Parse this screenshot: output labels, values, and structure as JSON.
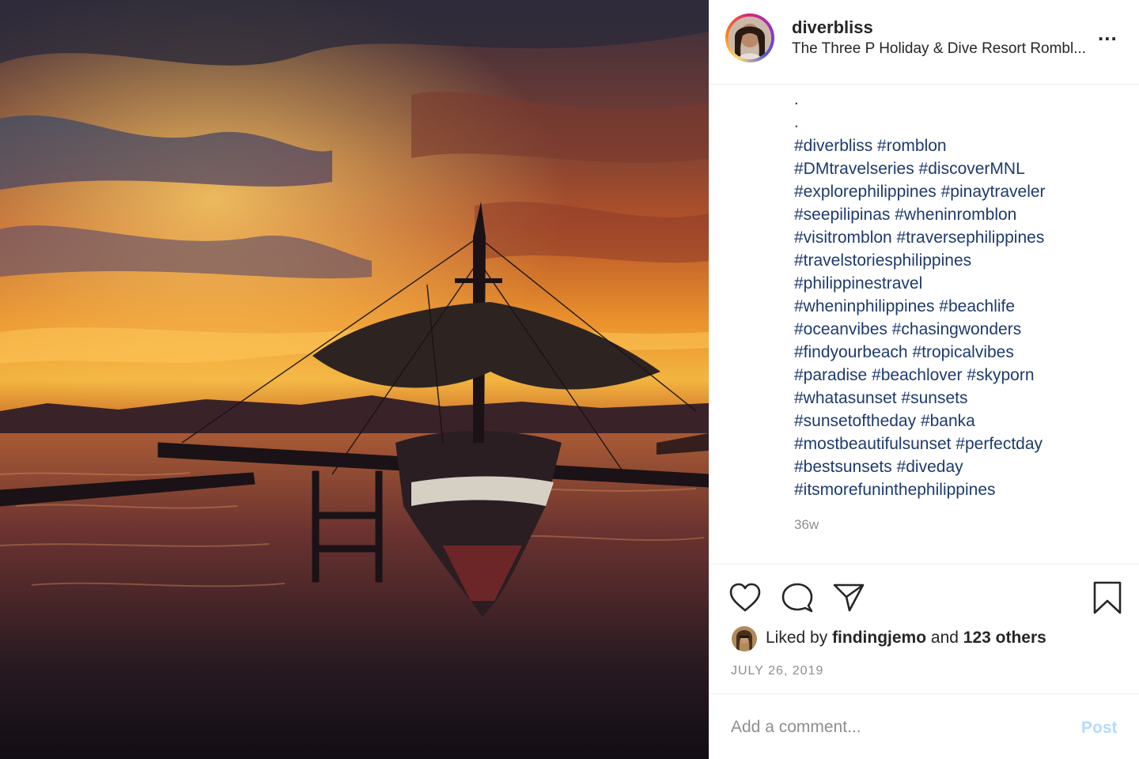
{
  "post": {
    "username": "diverbliss",
    "location": "The Three P Holiday & Dive Resort Rombl...",
    "more_label": "...",
    "caption_dots": [
      ".",
      "."
    ],
    "hashtag_lines": [
      "#diverbliss #romblon",
      "#DMtravelseries #discoverMNL",
      "#explorephilippines #pinaytraveler",
      "#seepilipinas #wheninromblon",
      "#visitromblon #traversephilippines",
      "#travelstoriesphilippines",
      "#philippinestravel",
      "#wheninphilippines #beachlife",
      "#oceanvibes #chasingwonders",
      "#findyourbeach #tropicalvibes",
      "#paradise #beachlover #skyporn",
      "#whatasunset #sunsets",
      "#sunsetoftheday #banka",
      "#mostbeautifulsunset #perfectday",
      "#bestsunsets #diveday",
      "#itsmorefuninthephilippines"
    ],
    "time_ago": "36w",
    "likes": {
      "prefix": "Liked by ",
      "user": "findingjemo",
      "middle": " and ",
      "others": "123 others"
    },
    "date": "JULY 26, 2019",
    "comment_placeholder": "Add a comment...",
    "post_button": "Post"
  },
  "icons": [
    "heart-icon",
    "comment-icon",
    "share-icon",
    "bookmark-icon",
    "more-options-icon"
  ],
  "colors": {
    "hashtag": "#1d3a6e",
    "muted": "#8e8e8e",
    "post_button": "#b3dbff",
    "border": "#efefef"
  }
}
